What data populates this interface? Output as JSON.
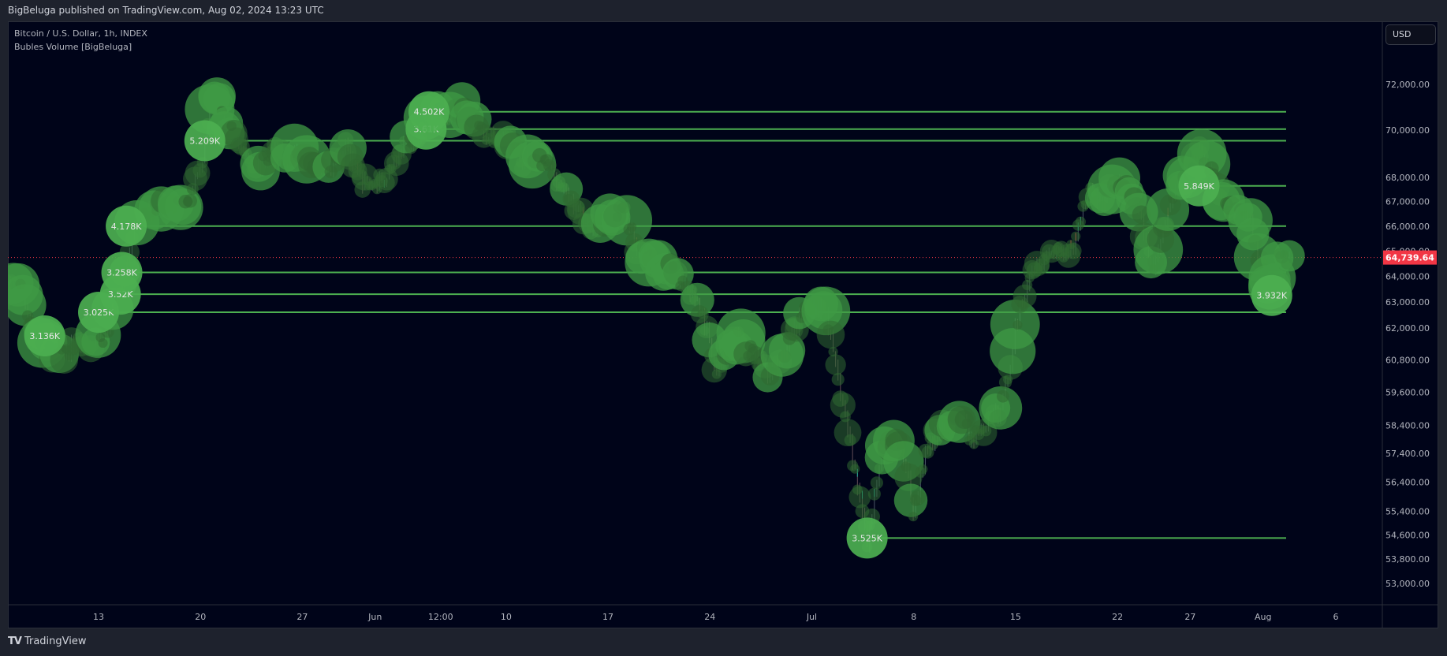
{
  "header": {
    "published_text": "BigBeluga published on TradingView.com, Aug 02, 2024 13:23 UTC"
  },
  "legend": {
    "symbol_line": "Bitcoin / U.S. Dollar, 1h, INDEX",
    "indicator_line": "Bubles Volume [BigBeluga]"
  },
  "currency_button": "USD",
  "footer": {
    "logo_glyph": "TV",
    "brand": "TradingView"
  },
  "colors": {
    "background": "#000419",
    "bubble_bright": "#4caf50",
    "bubble_dark": "#2e5e30",
    "level_line": "#4caf50",
    "last_price": "#f23645"
  },
  "chart_data": {
    "type": "scatter",
    "title": "Bitcoin / U.S. Dollar, 1h, INDEX",
    "indicator": "Bubles Volume [BigBeluga]",
    "scale": "log",
    "ylim": [
      52600,
      73200
    ],
    "price_ticks": [
      "72,000.00",
      "70,000.00",
      "68,000.00",
      "67,000.00",
      "66,000.00",
      "65,000.00",
      "64,000.00",
      "63,000.00",
      "62,000.00",
      "60,800.00",
      "59,600.00",
      "58,400.00",
      "57,400.00",
      "56,400.00",
      "55,400.00",
      "54,600.00",
      "53,800.00",
      "53,000.00"
    ],
    "price_tick_values": [
      72000,
      70000,
      68000,
      67000,
      66000,
      65000,
      64000,
      63000,
      62000,
      60800,
      59600,
      58400,
      57400,
      56400,
      55400,
      54600,
      53800,
      53000
    ],
    "last_price": {
      "value": 64739.64,
      "label": "64,739.64"
    },
    "time_ticks": [
      {
        "label": "13",
        "day": 13
      },
      {
        "label": "20",
        "day": 20
      },
      {
        "label": "27",
        "day": 27
      },
      {
        "label": "Jun",
        "day": 32
      },
      {
        "label": "12:00",
        "day": 36.5
      },
      {
        "label": "10",
        "day": 41
      },
      {
        "label": "17",
        "day": 48
      },
      {
        "label": "24",
        "day": 55
      },
      {
        "label": "Jul",
        "day": 62
      },
      {
        "label": "8",
        "day": 69
      },
      {
        "label": "15",
        "day": 76
      },
      {
        "label": "22",
        "day": 83
      },
      {
        "label": "27",
        "day": 88
      },
      {
        "label": "Aug",
        "day": 93
      },
      {
        "label": "6",
        "day": 98
      }
    ],
    "xlim_days": [
      6.2,
      101.6
    ],
    "price_path": [
      [
        6.3,
        63200
      ],
      [
        7.5,
        63800
      ],
      [
        8.5,
        62000
      ],
      [
        9.5,
        61200
      ],
      [
        10.5,
        60900
      ],
      [
        11.5,
        61500
      ],
      [
        12.5,
        61200
      ],
      [
        13.5,
        61800
      ],
      [
        14,
        62600
      ],
      [
        14.5,
        63700
      ],
      [
        15,
        64600
      ],
      [
        15.5,
        65800
      ],
      [
        16.5,
        66600
      ],
      [
        17.5,
        67000
      ],
      [
        18.5,
        66900
      ],
      [
        19.5,
        67400
      ],
      [
        20,
        68400
      ],
      [
        20.7,
        70900
      ],
      [
        21.2,
        71600
      ],
      [
        21.6,
        70200
      ],
      [
        22.3,
        69900
      ],
      [
        23,
        69000
      ],
      [
        24,
        68400
      ],
      [
        25,
        69100
      ],
      [
        26,
        68800
      ],
      [
        27,
        69200
      ],
      [
        28,
        68600
      ],
      [
        29,
        68400
      ],
      [
        30,
        69400
      ],
      [
        31,
        67800
      ],
      [
        32,
        67700
      ],
      [
        33,
        68300
      ],
      [
        34,
        69400
      ],
      [
        35,
        69700
      ],
      [
        36,
        70900
      ],
      [
        37,
        70700
      ],
      [
        38,
        71100
      ],
      [
        39,
        70200
      ],
      [
        40,
        69600
      ],
      [
        41,
        69800
      ],
      [
        42,
        68600
      ],
      [
        43,
        68700
      ],
      [
        44,
        68500
      ],
      [
        45,
        67400
      ],
      [
        46,
        66600
      ],
      [
        47,
        65800
      ],
      [
        48,
        66400
      ],
      [
        49,
        66800
      ],
      [
        50,
        65200
      ],
      [
        51,
        64600
      ],
      [
        52,
        64400
      ],
      [
        53,
        63800
      ],
      [
        54,
        63200
      ],
      [
        55,
        61400
      ],
      [
        55.5,
        60200
      ],
      [
        56,
        61200
      ],
      [
        57,
        61600
      ],
      [
        58,
        61000
      ],
      [
        59,
        60200
      ],
      [
        60,
        61000
      ],
      [
        61,
        62200
      ],
      [
        62,
        62900
      ],
      [
        63,
        62700
      ],
      [
        63.5,
        60700
      ],
      [
        64,
        59500
      ],
      [
        64.7,
        57500
      ],
      [
        65.3,
        55800
      ],
      [
        65.8,
        54500
      ],
      [
        66.5,
        56300
      ],
      [
        67,
        57500
      ],
      [
        67.5,
        57900
      ],
      [
        68.5,
        57200
      ],
      [
        69,
        55300
      ],
      [
        69.5,
        56600
      ],
      [
        70,
        57700
      ],
      [
        71,
        58200
      ],
      [
        72,
        58800
      ],
      [
        73,
        57900
      ],
      [
        74,
        58400
      ],
      [
        75,
        59000
      ],
      [
        75.5,
        60300
      ],
      [
        76,
        62000
      ],
      [
        76.5,
        63200
      ],
      [
        77,
        64300
      ],
      [
        78,
        64800
      ],
      [
        79,
        65200
      ],
      [
        79.5,
        64600
      ],
      [
        80,
        65200
      ],
      [
        80.5,
        66400
      ],
      [
        81,
        67500
      ],
      [
        82,
        66900
      ],
      [
        82.5,
        67600
      ],
      [
        83,
        68000
      ],
      [
        84,
        67000
      ],
      [
        84.5,
        66600
      ],
      [
        85,
        65300
      ],
      [
        85.5,
        64300
      ],
      [
        86,
        65500
      ],
      [
        86.5,
        66500
      ],
      [
        87,
        67700
      ],
      [
        88,
        68200
      ],
      [
        88.7,
        69200
      ],
      [
        89.3,
        68500
      ],
      [
        90,
        67400
      ],
      [
        91,
        66600
      ],
      [
        92,
        66400
      ],
      [
        92.8,
        64700
      ],
      [
        93.5,
        63700
      ],
      [
        94.2,
        64800
      ],
      [
        94.9,
        64700
      ]
    ],
    "volume_bubbles": [
      {
        "label": "3.136K",
        "day": 9.3,
        "price": 61700,
        "level": null
      },
      {
        "label": "3.025K",
        "day": 13,
        "price": 62600,
        "level": 62600
      },
      {
        "label": "3.52K",
        "day": 14.5,
        "price": 63300,
        "level": 63300
      },
      {
        "label": "3.258K",
        "day": 14.6,
        "price": 64150,
        "level": 64150
      },
      {
        "label": "4.178K",
        "day": 14.9,
        "price": 66000,
        "level": 66000
      },
      {
        "label": "5.209K",
        "day": 20.3,
        "price": 69550,
        "level": 69550
      },
      {
        "label": "3.61K",
        "day": 35.5,
        "price": 70050,
        "level": 70050
      },
      {
        "label": "4.502K",
        "day": 35.7,
        "price": 70800,
        "level": 70800
      },
      {
        "label": "3.525K",
        "day": 65.8,
        "price": 54500,
        "level": 54500
      },
      {
        "label": "5.849K",
        "day": 88.6,
        "price": 67650,
        "level": 67650
      },
      {
        "label": "3.932K",
        "day": 93.6,
        "price": 63250,
        "level": null
      }
    ],
    "xlabel": "",
    "ylabel": "",
    "grid": false,
    "legend_position": "top-left"
  }
}
